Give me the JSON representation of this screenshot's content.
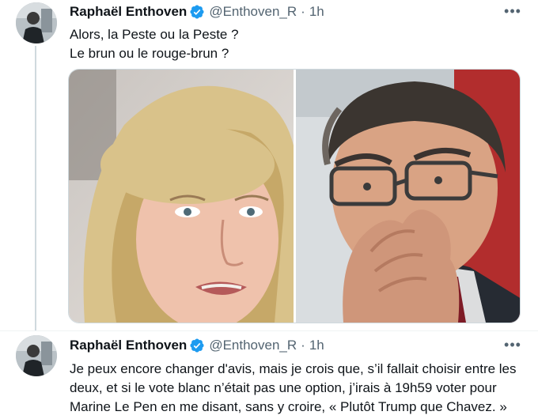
{
  "tweets": [
    {
      "author_name": "Raphaël Enthoven",
      "handle": "@Enthoven_R",
      "separator": "·",
      "time": "1h",
      "lines": [
        "Alors, la Peste ou la Peste ?",
        "Le brun ou le rouge-brun ?"
      ],
      "media": [
        {
          "icon": "photo-left-icon"
        },
        {
          "icon": "photo-right-icon"
        }
      ]
    },
    {
      "author_name": "Raphaël Enthoven",
      "handle": "@Enthoven_R",
      "separator": "·",
      "time": "1h",
      "text": "Je peux encore changer d'avis, mais je crois que, s’il fallait choisir entre les deux, et si le vote blanc n’était pas une option, j’irais à 19h59 voter pour Marine Le Pen en me disant, sans y croire, « Plutôt Trump que Chavez. »"
    }
  ],
  "more_icon": "more-options-icon",
  "colors": {
    "verified": "#1d9bf0",
    "secondary_text": "#536471",
    "thread_line": "#cfd9de"
  }
}
